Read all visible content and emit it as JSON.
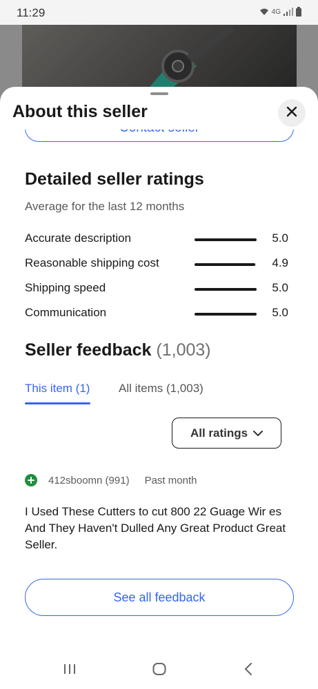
{
  "status_bar": {
    "time": "11:29",
    "network": "4G",
    "icons": [
      "wifi-icon",
      "signal-icon",
      "battery-icon"
    ]
  },
  "sheet": {
    "title": "About this seller",
    "close_icon": "close-icon"
  },
  "contact_button": {
    "label": "Contact seller"
  },
  "detailed_ratings": {
    "title": "Detailed seller ratings",
    "subtitle": "Average for the last 12 months",
    "rows": [
      {
        "label": "Accurate description",
        "value": "5.0",
        "fraction": 1.0
      },
      {
        "label": "Reasonable shipping cost",
        "value": "4.9",
        "fraction": 0.98
      },
      {
        "label": "Shipping speed",
        "value": "5.0",
        "fraction": 1.0
      },
      {
        "label": "Communication",
        "value": "5.0",
        "fraction": 1.0
      }
    ]
  },
  "seller_feedback": {
    "title": "Seller feedback",
    "count": "(1,003)",
    "tabs": [
      {
        "label": "This item (1)",
        "active": true
      },
      {
        "label": "All items (1,003)",
        "active": false
      }
    ],
    "filter": {
      "label": "All ratings",
      "icon": "chevron-down-icon"
    },
    "entry": {
      "badge_icon": "plus-circle-icon",
      "user": "412sboomn (991)",
      "time": "Past month",
      "comment": "I Used These Cutters to cut 800 22 Guage Wir es And They Haven't Dulled Any Great Product Great Seller."
    },
    "see_all_label": "See all feedback"
  },
  "nav_bar": {
    "items": [
      "recent-apps-icon",
      "home-icon",
      "back-icon"
    ]
  },
  "colors": {
    "accent": "#3665f3",
    "positive": "#1e8f3e",
    "text": "#191919"
  }
}
